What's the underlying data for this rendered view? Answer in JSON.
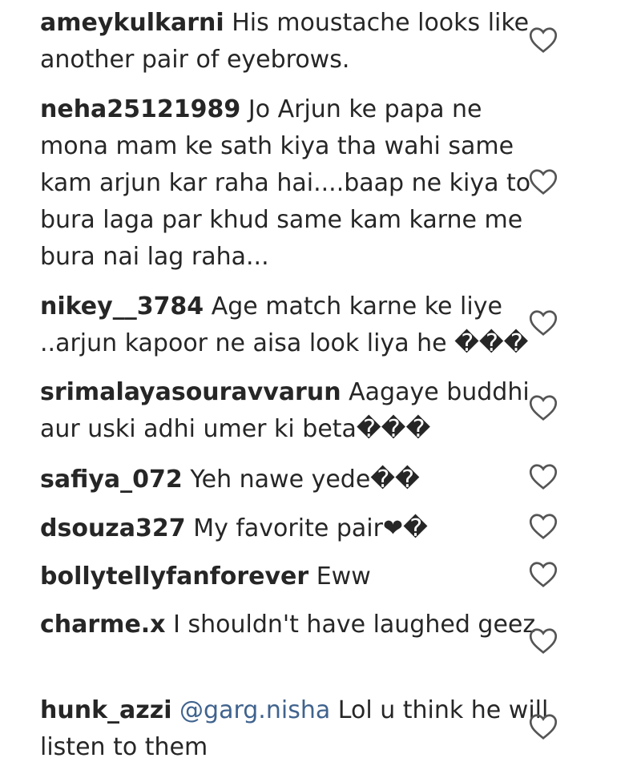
{
  "comments": [
    {
      "username": "ameykulkarni",
      "mention": "",
      "text": "His moustache looks like another pair of eyebrows."
    },
    {
      "username": "neha25121989",
      "mention": "",
      "text": "Jo Arjun ke papa ne mona mam ke sath kiya tha wahi same kam arjun kar raha hai....baap ne kiya to bura laga par khud same kam karne me bura nai lag raha..."
    },
    {
      "username": "nikey__3784",
      "mention": "",
      "text": "Age match karne ke liye ..arjun kapoor ne aisa look liya he ���"
    },
    {
      "username": "srimalayasouravvarun",
      "mention": "",
      "text": "Aagaye buddhi aur uski adhi umer ki beta���"
    },
    {
      "username": "safiya_072",
      "mention": "",
      "text": "Yeh nawe yede��"
    },
    {
      "username": "dsouza327",
      "mention": "",
      "text": "My favorite pair❤�"
    },
    {
      "username": "bollytellyfanforever",
      "mention": "",
      "text": "Eww"
    },
    {
      "username": "charme.x",
      "mention": "",
      "text": "I shouldn't have laughed geez"
    },
    {
      "username": "hunk_azzi",
      "mention": "@garg.nisha",
      "text": "Lol u think he will listen to them"
    }
  ]
}
